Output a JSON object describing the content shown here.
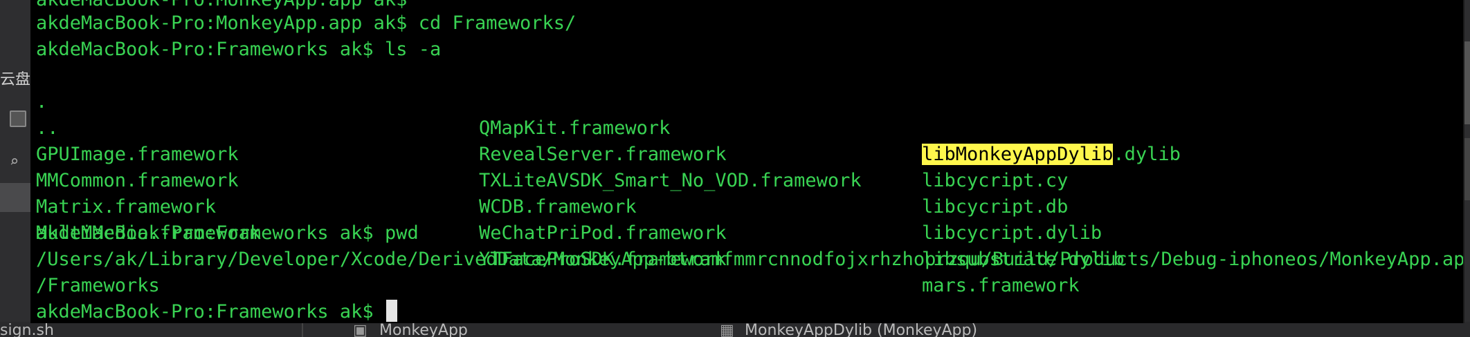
{
  "colors": {
    "terminal_bg": "#000000",
    "terminal_text": "#39d353",
    "search_highlight": "#fff74c",
    "cursor": "#e6e6e6"
  },
  "background_window": {
    "sidebar_label": "云盘",
    "bottom_left_text": "sign.sh",
    "bottom_tab_1": "MonkeyApp",
    "bottom_tab_2": "MonkeyAppDylib (MonkeyApp)"
  },
  "terminal": {
    "lines": [
      {
        "prompt": "akdeMacBook-Pro:MonkeyApp.app ak$",
        "command": "cd Frameworks/"
      },
      {
        "prompt": "akdeMacBook-Pro:Frameworks ak$",
        "command": "ls -a"
      }
    ],
    "listing": {
      "col1": [
        ".",
        "..",
        "GPUImage.framework",
        "MMCommon.framework",
        "Matrix.framework",
        "MultiMedia.framework"
      ],
      "col2": [
        "QMapKit.framework",
        "RevealServer.framework",
        "TXLiteAVSDK_Smart_No_VOD.framework",
        "WCDB.framework",
        "WeChatPriPod.framework",
        "YTFaceProSDK.framework"
      ],
      "col3_first_highlight": "libMonkeyAppDylib",
      "col3_first_rest": ".dylib",
      "col3": [
        "libcycript.cy",
        "libcycript.db",
        "libcycript.dylib",
        "libsubstrate.dylib",
        "mars.framework"
      ]
    },
    "pwd_prompt": "akdeMacBook-Pro:Frameworks ak$",
    "pwd_command": "pwd",
    "pwd_output_1": "/Users/ak/Library/Developer/Xcode/DerivedData/MonkeyApp-btramfmmrcnnodfojxrhzhoprzqu/Build/Products/Debug-iphoneos/MonkeyApp.app",
    "pwd_output_2": "/Frameworks",
    "final_prompt": "akdeMacBook-Pro:Frameworks ak$",
    "top_cut_line": "akdeMacBook-Pro:MonkeyApp.app ak$"
  }
}
